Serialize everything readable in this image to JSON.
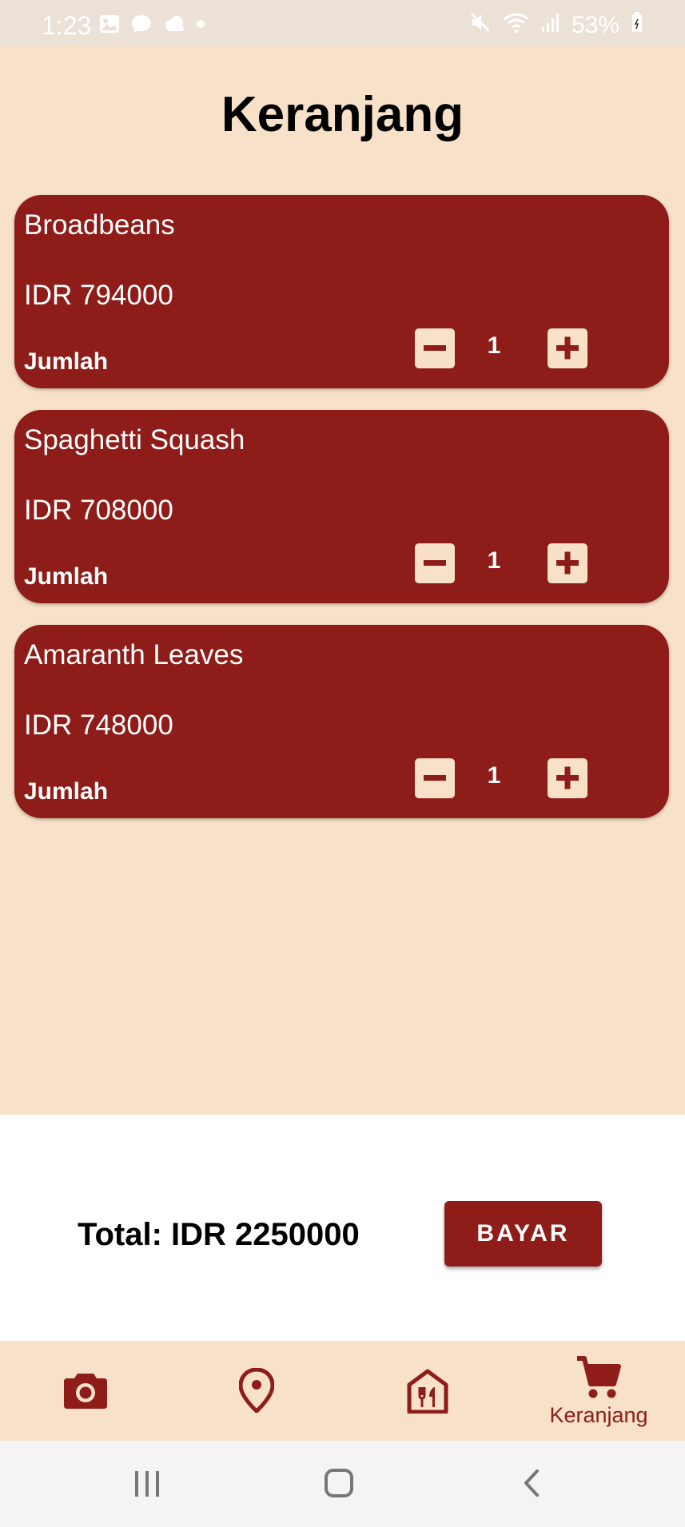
{
  "status_bar": {
    "time": "1:23",
    "battery": "53%",
    "left_icons": [
      "gallery-icon",
      "chat-bubble-icon",
      "cloud-icon",
      "dot-icon"
    ],
    "right_icons": [
      "mute-icon",
      "wifi-icon",
      "signal-icon",
      "battery-icon"
    ]
  },
  "page": {
    "title": "Keranjang"
  },
  "cart": {
    "items": [
      {
        "name": "Broadbeans",
        "price": "IDR 794000",
        "qty_label": "Jumlah",
        "quantity": "1"
      },
      {
        "name": "Spaghetti Squash",
        "price": "IDR 708000",
        "qty_label": "Jumlah",
        "quantity": "1"
      },
      {
        "name": "Amaranth Leaves",
        "price": "IDR 748000",
        "qty_label": "Jumlah",
        "quantity": "1"
      }
    ]
  },
  "checkout": {
    "total": "Total: IDR 2250000",
    "pay_label": "BAYAR"
  },
  "bottom_nav": {
    "items": [
      {
        "icon": "camera-icon",
        "label": ""
      },
      {
        "icon": "location-pin-icon",
        "label": ""
      },
      {
        "icon": "restaurant-icon",
        "label": ""
      },
      {
        "icon": "cart-icon",
        "label": "Keranjang",
        "active": true
      }
    ]
  },
  "colors": {
    "primary": "#8e1c18",
    "background": "#f7e1c8",
    "status_bar": "#ece1d6",
    "system_nav": "#f4f4f4"
  }
}
